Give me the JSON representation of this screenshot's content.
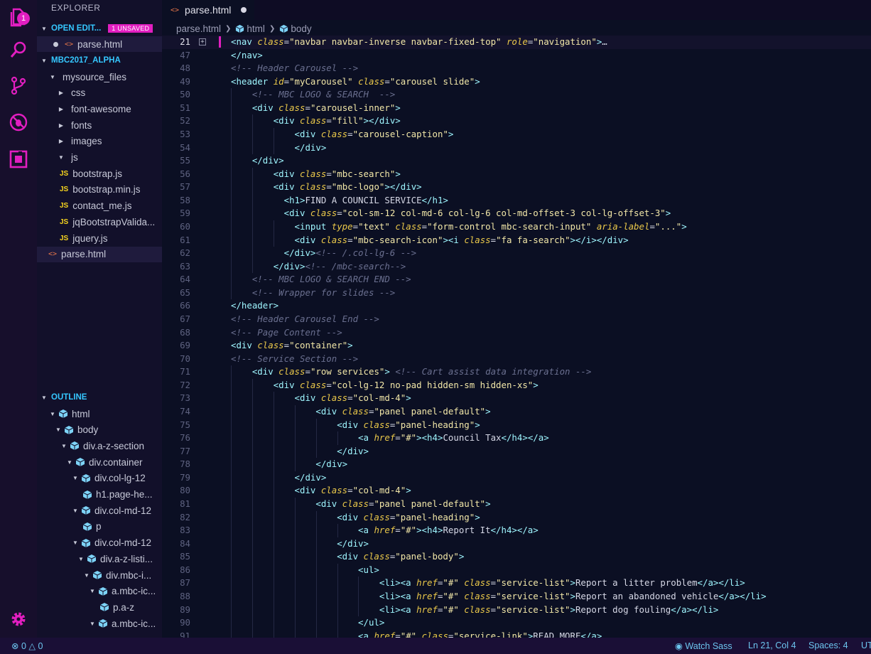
{
  "activity_bar": {
    "explorer_badge": "1",
    "icons": [
      "files-icon",
      "search-icon",
      "source-control-icon",
      "debug-icon",
      "extensions-icon",
      "gear-icon"
    ]
  },
  "sidebar": {
    "title": "EXPLORER",
    "open_editors": {
      "label": "OPEN EDIT...",
      "badge": "1 UNSAVED",
      "files": [
        "parse.html"
      ]
    },
    "workspace": {
      "label": "MBC2017_ALPHA",
      "tree": [
        {
          "label": "mysource_files",
          "type": "folder-open"
        },
        {
          "label": "css",
          "type": "folder"
        },
        {
          "label": "font-awesome",
          "type": "folder"
        },
        {
          "label": "fonts",
          "type": "folder"
        },
        {
          "label": "images",
          "type": "folder"
        },
        {
          "label": "js",
          "type": "folder-open"
        },
        {
          "label": "bootstrap.js",
          "type": "js"
        },
        {
          "label": "bootstrap.min.js",
          "type": "js"
        },
        {
          "label": "contact_me.js",
          "type": "js"
        },
        {
          "label": "jqBootstrapValida...",
          "type": "js"
        },
        {
          "label": "jquery.js",
          "type": "js"
        },
        {
          "label": "parse.html",
          "type": "html"
        }
      ]
    },
    "outline": {
      "label": "OUTLINE",
      "items": [
        "html",
        "body",
        "div.a-z-section",
        "div.container",
        "div.col-lg-12",
        "h1.page-he...",
        "div.col-md-12",
        "p",
        "div.col-md-12",
        "div.a-z-listi...",
        "div.mbc-i...",
        "a.mbc-ic...",
        "p.a-z",
        "a.mbc-ic..."
      ]
    }
  },
  "editor": {
    "tab_label": "parse.html",
    "breadcrumb": [
      "parse.html",
      "html",
      "body"
    ],
    "lines": [
      {
        "n": "21",
        "html": "<span class=\"tag\">&lt;nav</span> <span class=\"attr\">class</span>=<span class=\"str\">\"navbar navbar-inverse navbar-fixed-top\"</span> <span class=\"attr\">role</span>=<span class=\"str\">\"navigation\"</span><span class=\"tag\">&gt;</span>…"
      },
      {
        "n": "47",
        "html": "<span class=\"tag\">&lt;/nav&gt;</span>"
      },
      {
        "n": "48",
        "html": "<span class=\"cmt\">&lt;!-- Header Carousel --&gt;</span>"
      },
      {
        "n": "49",
        "html": "<span class=\"tag\">&lt;header</span> <span class=\"attr\">id</span>=<span class=\"str\">\"myCarousel\"</span> <span class=\"attr\">class</span>=<span class=\"str\">\"carousel slide\"</span><span class=\"tag\">&gt;</span>"
      },
      {
        "n": "50",
        "html": "    <span class=\"cmt\">&lt;!-- MBC LOGO &amp; SEARCH  --&gt;</span>"
      },
      {
        "n": "51",
        "html": "    <span class=\"tag\">&lt;div</span> <span class=\"attr\">class</span>=<span class=\"str\">\"carousel-inner\"</span><span class=\"tag\">&gt;</span>"
      },
      {
        "n": "52",
        "html": "        <span class=\"tag\">&lt;div</span> <span class=\"attr\">class</span>=<span class=\"str\">\"fill\"</span><span class=\"tag\">&gt;&lt;/div&gt;</span>"
      },
      {
        "n": "53",
        "html": "            <span class=\"tag\">&lt;div</span> <span class=\"attr\">class</span>=<span class=\"str\">\"carousel-caption\"</span><span class=\"tag\">&gt;</span>"
      },
      {
        "n": "54",
        "html": "            <span class=\"tag\">&lt;/div&gt;</span>"
      },
      {
        "n": "55",
        "html": "    <span class=\"tag\">&lt;/div&gt;</span>"
      },
      {
        "n": "56",
        "html": "        <span class=\"tag\">&lt;div</span> <span class=\"attr\">class</span>=<span class=\"str\">\"mbc-search\"</span><span class=\"tag\">&gt;</span>"
      },
      {
        "n": "57",
        "html": "        <span class=\"tag\">&lt;div</span> <span class=\"attr\">class</span>=<span class=\"str\">\"mbc-logo\"</span><span class=\"tag\">&gt;&lt;/div&gt;</span>"
      },
      {
        "n": "58",
        "html": "          <span class=\"tag\">&lt;h1&gt;</span>FIND A COUNCIL SERVICE<span class=\"tag\">&lt;/h1&gt;</span>"
      },
      {
        "n": "59",
        "html": "          <span class=\"tag\">&lt;div</span> <span class=\"attr\">class</span>=<span class=\"str\">\"col-sm-12 col-md-6 col-lg-6 col-md-offset-3 col-lg-offset-3\"</span><span class=\"tag\">&gt;</span>"
      },
      {
        "n": "60",
        "html": "            <span class=\"tag\">&lt;input</span> <span class=\"attr\">type</span>=<span class=\"str\">\"text\"</span> <span class=\"attr\">class</span>=<span class=\"str\">\"form-control mbc-search-input\"</span> <span class=\"attr\">aria-label</span>=<span class=\"str\">\"...\"</span><span class=\"tag\">&gt;</span>"
      },
      {
        "n": "61",
        "html": "            <span class=\"tag\">&lt;div</span> <span class=\"attr\">class</span>=<span class=\"str\">\"mbc-search-icon\"</span><span class=\"tag\">&gt;&lt;i</span> <span class=\"attr\">class</span>=<span class=\"str\">\"fa fa-search\"</span><span class=\"tag\">&gt;&lt;/i&gt;&lt;/div&gt;</span>"
      },
      {
        "n": "62",
        "html": "          <span class=\"tag\">&lt;/div&gt;</span><span class=\"cmt\">&lt;!-- /.col-lg-6 --&gt;</span>"
      },
      {
        "n": "63",
        "html": "        <span class=\"tag\">&lt;/div&gt;</span><span class=\"cmt\">&lt;!-- /mbc-search--&gt;</span>"
      },
      {
        "n": "64",
        "html": "    <span class=\"cmt\">&lt;!-- MBC LOGO &amp; SEARCH END --&gt;</span>"
      },
      {
        "n": "65",
        "html": "    <span class=\"cmt\">&lt;!-- Wrapper for slides --&gt;</span>"
      },
      {
        "n": "66",
        "html": "<span class=\"tag\">&lt;/header&gt;</span>"
      },
      {
        "n": "67",
        "html": "<span class=\"cmt\">&lt;!-- Header Carousel End --&gt;</span>"
      },
      {
        "n": "68",
        "html": "<span class=\"cmt\">&lt;!-- Page Content --&gt;</span>"
      },
      {
        "n": "69",
        "html": "<span class=\"tag\">&lt;div</span> <span class=\"attr\">class</span>=<span class=\"str\">\"container\"</span><span class=\"tag\">&gt;</span>"
      },
      {
        "n": "70",
        "html": "<span class=\"cmt\">&lt;!-- Service Section --&gt;</span>"
      },
      {
        "n": "71",
        "html": "    <span class=\"tag\">&lt;div</span> <span class=\"attr\">class</span>=<span class=\"str\">\"row services\"</span><span class=\"tag\">&gt;</span> <span class=\"cmt\">&lt;!-- Cart assist data integration --&gt;</span>"
      },
      {
        "n": "72",
        "html": "        <span class=\"tag\">&lt;div</span> <span class=\"attr\">class</span>=<span class=\"str\">\"col-lg-12 no-pad hidden-sm hidden-xs\"</span><span class=\"tag\">&gt;</span>"
      },
      {
        "n": "73",
        "html": "            <span class=\"tag\">&lt;div</span> <span class=\"attr\">class</span>=<span class=\"str\">\"col-md-4\"</span><span class=\"tag\">&gt;</span>"
      },
      {
        "n": "74",
        "html": "                <span class=\"tag\">&lt;div</span> <span class=\"attr\">class</span>=<span class=\"str\">\"panel panel-default\"</span><span class=\"tag\">&gt;</span>"
      },
      {
        "n": "75",
        "html": "                    <span class=\"tag\">&lt;div</span> <span class=\"attr\">class</span>=<span class=\"str\">\"panel-heading\"</span><span class=\"tag\">&gt;</span>"
      },
      {
        "n": "76",
        "html": "                        <span class=\"tag\">&lt;a</span> <span class=\"attr\">href</span>=<span class=\"str\">\"#\"</span><span class=\"tag\">&gt;&lt;h4&gt;</span>Council Tax<span class=\"tag\">&lt;/h4&gt;&lt;/a&gt;</span>"
      },
      {
        "n": "77",
        "html": "                    <span class=\"tag\">&lt;/div&gt;</span>"
      },
      {
        "n": "78",
        "html": "                <span class=\"tag\">&lt;/div&gt;</span>"
      },
      {
        "n": "79",
        "html": "            <span class=\"tag\">&lt;/div&gt;</span>"
      },
      {
        "n": "80",
        "html": "            <span class=\"tag\">&lt;div</span> <span class=\"attr\">class</span>=<span class=\"str\">\"col-md-4\"</span><span class=\"tag\">&gt;</span>"
      },
      {
        "n": "81",
        "html": "                <span class=\"tag\">&lt;div</span> <span class=\"attr\">class</span>=<span class=\"str\">\"panel panel-default\"</span><span class=\"tag\">&gt;</span>"
      },
      {
        "n": "82",
        "html": "                    <span class=\"tag\">&lt;div</span> <span class=\"attr\">class</span>=<span class=\"str\">\"panel-heading\"</span><span class=\"tag\">&gt;</span>"
      },
      {
        "n": "83",
        "html": "                        <span class=\"tag\">&lt;a</span> <span class=\"attr\">href</span>=<span class=\"str\">\"#\"</span><span class=\"tag\">&gt;&lt;h4&gt;</span>Report It<span class=\"tag\">&lt;/h4&gt;&lt;/a&gt;</span>"
      },
      {
        "n": "84",
        "html": "                    <span class=\"tag\">&lt;/div&gt;</span>"
      },
      {
        "n": "85",
        "html": "                    <span class=\"tag\">&lt;div</span> <span class=\"attr\">class</span>=<span class=\"str\">\"panel-body\"</span><span class=\"tag\">&gt;</span>"
      },
      {
        "n": "86",
        "html": "                        <span class=\"tag\">&lt;ul&gt;</span>"
      },
      {
        "n": "87",
        "html": "                            <span class=\"tag\">&lt;li&gt;&lt;a</span> <span class=\"attr\">href</span>=<span class=\"str\">\"#\"</span> <span class=\"attr\">class</span>=<span class=\"str\">\"service-list\"</span><span class=\"tag\">&gt;</span>Report a litter problem<span class=\"tag\">&lt;/a&gt;&lt;/li&gt;</span>"
      },
      {
        "n": "88",
        "html": "                            <span class=\"tag\">&lt;li&gt;&lt;a</span> <span class=\"attr\">href</span>=<span class=\"str\">\"#\"</span> <span class=\"attr\">class</span>=<span class=\"str\">\"service-list\"</span><span class=\"tag\">&gt;</span>Report an abandoned vehicle<span class=\"tag\">&lt;/a&gt;&lt;/li&gt;</span>"
      },
      {
        "n": "89",
        "html": "                            <span class=\"tag\">&lt;li&gt;&lt;a</span> <span class=\"attr\">href</span>=<span class=\"str\">\"#\"</span> <span class=\"attr\">class</span>=<span class=\"str\">\"service-list\"</span><span class=\"tag\">&gt;</span>Report dog fouling<span class=\"tag\">&lt;/a&gt;&lt;/li&gt;</span>"
      },
      {
        "n": "90",
        "html": "                        <span class=\"tag\">&lt;/ul&gt;</span>"
      },
      {
        "n": "91",
        "html": "                        <span class=\"tag\">&lt;a</span> <span class=\"attr\">href</span>=<span class=\"str\">\"#\"</span> <span class=\"attr\">class</span>=<span class=\"str\">\"service-link\"</span><span class=\"tag\">&gt;</span>READ MORE<span class=\"tag\">&lt;/a&gt;</span>"
      }
    ]
  },
  "status_bar": {
    "errors": "0",
    "warnings": "0",
    "watch_sass": "Watch Sass",
    "position": "Ln 21, Col 4",
    "spaces": "Spaces: 4",
    "encoding": "UT"
  },
  "colors": {
    "accent": "#e21ec0",
    "section_header": "#35c7ff",
    "tag": "#9ff6ff",
    "attribute": "#eac84a",
    "string": "#f2e7a8",
    "comment": "#6a6f8f"
  }
}
